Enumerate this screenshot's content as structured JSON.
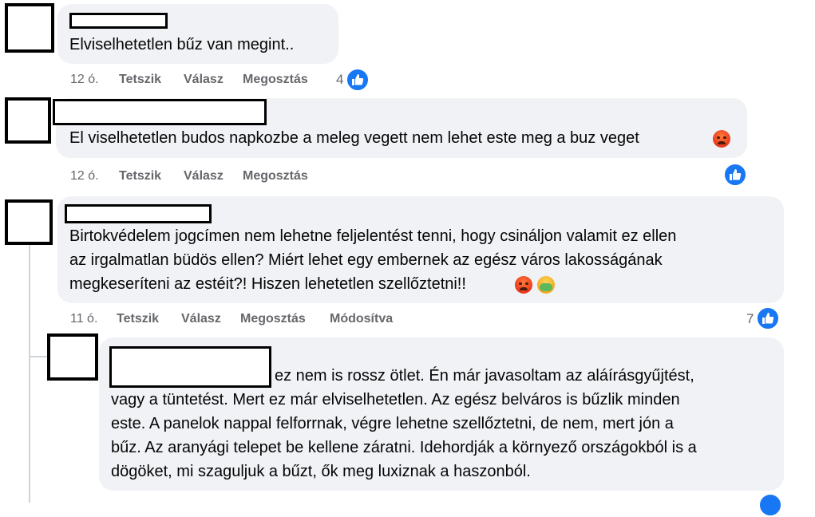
{
  "colors": {
    "bubble": "#f0f2f5",
    "like": "#1877f2",
    "meta": "#65676b",
    "angry_emoji": "#e8331b",
    "sick_emoji": "#5cb85c"
  },
  "comments": [
    {
      "text": "Elviselhetetlen bűz van megint..",
      "meta": {
        "time": "12 ó.",
        "like": "Tetszik",
        "reply": "Válasz",
        "share": "Megosztás"
      },
      "reactions": {
        "count": "4",
        "icon": "thumbs-up-icon"
      }
    },
    {
      "text": "El viselhetetlen budos napkozbe a meleg vegett nem lehet este meg a buz veget",
      "emojis": [
        "angry-face-emoji"
      ],
      "meta": {
        "time": "12 ó.",
        "like": "Tetszik",
        "reply": "Válasz",
        "share": "Megosztás"
      },
      "reactions": {
        "icon": "thumbs-up-icon"
      }
    },
    {
      "lines": [
        "Birtokvédelem jogcímen nem lehetne feljelentést tenni, hogy csináljon valamit ez ellen",
        "az irgalmatlan büdös ellen? Miért lehet egy embernek az egész város lakosságának",
        "megkeseríteni az estéit?! Hiszen lehetetlen szellőztetni!!"
      ],
      "emojis": [
        "angry-face-emoji",
        "nauseated-face-emoji"
      ],
      "meta": {
        "time": "11 ó.",
        "like": "Tetszik",
        "reply": "Válasz",
        "share": "Megosztás",
        "edited": "Módosítva"
      },
      "reactions": {
        "count": "7",
        "icon": "thumbs-up-icon"
      }
    },
    {
      "lines": [
        "ez nem is rossz ötlet. Én már javasoltam az aláírásgyűjtést,",
        "vagy a tüntetést. Mert ez már elviselhetetlen. Az egész belváros is bűzlik minden",
        "este. A panelok nappal felforrnak, végre lehetne szellőztetni, de nem, mert jón a",
        "bűz. Az aranyági telepet be kellene záratni. Idehordják a környező országokból is a",
        "dögöket, mi szaguljuk a bűzt, ők meg luxiznak a haszonból."
      ]
    }
  ]
}
